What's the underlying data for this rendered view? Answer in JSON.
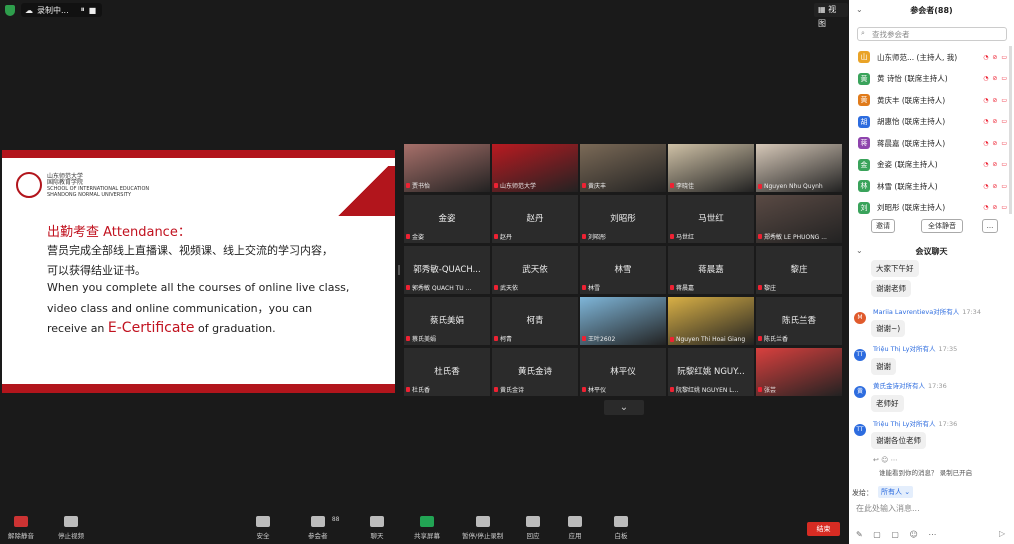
{
  "topbar": {
    "recording_label": "录制中...",
    "view_label": "视图"
  },
  "slide": {
    "uni_name_cn": "山东师范大学",
    "uni_school_cn": "国际教育学院",
    "uni_en1": "SCHOOL OF INTERNATIONAL EDUCATION",
    "uni_en2": "SHANDONG NORMAL UNIVERSITY",
    "heading": "出勤考查 Attendance：",
    "line1": "营员完成全部线上直播课、视频课、线上交流的学习内容，",
    "line2": "可以获得结业证书。",
    "line3": "When you complete all the courses of online live class,",
    "line4": "video class and online communication，you can",
    "line5a": "receive an ",
    "line5b": "E-Certificate",
    "line5c": " of graduation."
  },
  "tiles": [
    {
      "name": "",
      "label": "贾书怡",
      "photo": "#a7706a"
    },
    {
      "name": "",
      "label": "山东师范大学",
      "photo": "#b91a21"
    },
    {
      "name": "",
      "label": "黄庆丰",
      "photo": "#7b6a57"
    },
    {
      "name": "",
      "label": "李晓佳",
      "photo": "#cfc1a6"
    },
    {
      "name": "",
      "label": "Nguyen Nhu Quynh",
      "photo": "#d6c8b8"
    },
    {
      "name": "金姿",
      "label": "金姿"
    },
    {
      "name": "赵丹",
      "label": "赵丹"
    },
    {
      "name": "刘昭彤",
      "label": "刘昭彤"
    },
    {
      "name": "马世红",
      "label": "马世红"
    },
    {
      "name": "",
      "label": "郑秀敏 LE PHUONG ...",
      "photo": "#5a4a44"
    },
    {
      "name": "郭秀敏-QUACH...",
      "label": "郭秀敏 QUACH TU ..."
    },
    {
      "name": "武天依",
      "label": "武天依"
    },
    {
      "name": "林雪",
      "label": "林雪"
    },
    {
      "name": "蒋晨嘉",
      "label": "蒋晨嘉"
    },
    {
      "name": "黎庄",
      "label": "黎庄"
    },
    {
      "name": "蔡氏美娟",
      "label": "蔡氏美娟"
    },
    {
      "name": "柯青",
      "label": "柯青"
    },
    {
      "name": "",
      "label": "王叶2602",
      "photo": "#7fb6d9"
    },
    {
      "name": "",
      "label": "Nguyen Thi Hoai Giang",
      "photo": "#d9b046"
    },
    {
      "name": "陈氏兰香",
      "label": "陈氏兰香"
    },
    {
      "name": "杜氏香",
      "label": "杜氏香"
    },
    {
      "name": "黄氏金诗",
      "label": "黄氏金诗"
    },
    {
      "name": "林平仪",
      "label": "林平仪"
    },
    {
      "name": "阮黎红姚 NGUY...",
      "label": "阮黎红姚 NGUYEN L..."
    },
    {
      "name": "",
      "label": "张芸",
      "photo": "#d9403e"
    }
  ],
  "grid_chevron": "⌄",
  "toolbar": {
    "items": [
      {
        "label": "解除静音",
        "icon": "mic-muted-icon"
      },
      {
        "label": "停止视频",
        "icon": "video-icon"
      },
      {
        "label": "安全",
        "icon": "shield-icon"
      },
      {
        "label": "参会者",
        "icon": "participants-icon",
        "count": "88"
      },
      {
        "label": "聊天",
        "icon": "chat-icon"
      },
      {
        "label": "共享屏幕",
        "icon": "share-screen-icon"
      },
      {
        "label": "暂停/停止录制",
        "icon": "record-icon"
      },
      {
        "label": "回应",
        "icon": "reaction-icon"
      },
      {
        "label": "应用",
        "icon": "apps-icon"
      },
      {
        "label": "白板",
        "icon": "whiteboard-icon"
      }
    ],
    "end_label": "结束"
  },
  "participants": {
    "title": "参会者(88)",
    "search_placeholder": "查找参会者",
    "rows": [
      {
        "avatar": "山",
        "color": "#e9a327",
        "name": "山东师范... (主持人, 我)"
      },
      {
        "avatar": "黄",
        "color": "#3aa35b",
        "name": "黄 诗怡 (联席主持人)"
      },
      {
        "avatar": "黄",
        "color": "#e07b1b",
        "name": "黄庆丰 (联席主持人)"
      },
      {
        "avatar": "胡",
        "color": "#2d6cdf",
        "name": "胡惠怡 (联席主持人)"
      },
      {
        "avatar": "蒋",
        "color": "#8e44ad",
        "name": "蒋晨嘉 (联席主持人)"
      },
      {
        "avatar": "金",
        "color": "#3aa35b",
        "name": "金姿 (联席主持人)"
      },
      {
        "avatar": "林",
        "color": "#3aa35b",
        "name": "林雪 (联席主持人)"
      },
      {
        "avatar": "刘",
        "color": "#3aa35b",
        "name": "刘昭彤 (联席主持人)"
      }
    ],
    "invite": "邀请",
    "mute_all": "全体静音",
    "more": "..."
  },
  "chat": {
    "title": "会议聊天",
    "messages": [
      {
        "who": "",
        "time": "",
        "text": "大家下午好",
        "avatar": "",
        "color": ""
      },
      {
        "who": "",
        "time": "",
        "text": "谢谢老师",
        "avatar": "",
        "color": ""
      },
      {
        "who": "Mariia Lavrentieva对所有人",
        "time": "17:34",
        "text": "谢谢~)",
        "avatar": "M",
        "color": "#e05a2c"
      },
      {
        "who": "Triệu Thị Ly对所有人",
        "time": "17:35",
        "text": "谢谢",
        "avatar": "TT",
        "color": "#2d6cdf"
      },
      {
        "who": "黄氏金诗对所有人",
        "time": "17:36",
        "text": "老师好",
        "avatar": "黄",
        "color": "#2d6cdf"
      },
      {
        "who": "Triệu Thị Ly对所有人",
        "time": "17:36",
        "text": "谢谢各位老师",
        "avatar": "TT",
        "color": "#2d6cdf"
      }
    ],
    "notice": "谁能看到你的消息？ 录制已开启",
    "send_to_label": "发给：",
    "send_to_value": "所有人 ⌄",
    "input_placeholder": "在此处输入消息..."
  }
}
